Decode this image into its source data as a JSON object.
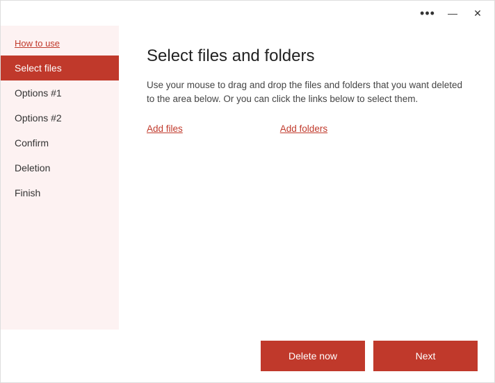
{
  "titleBar": {
    "dotsLabel": "•••",
    "minimizeLabel": "—",
    "closeLabel": "✕"
  },
  "sidebar": {
    "items": [
      {
        "id": "how-to-use",
        "label": "How to use",
        "active": false,
        "isLink": true
      },
      {
        "id": "select-files",
        "label": "Select files",
        "active": true,
        "isLink": false
      },
      {
        "id": "options-1",
        "label": "Options #1",
        "active": false,
        "isLink": false
      },
      {
        "id": "options-2",
        "label": "Options #2",
        "active": false,
        "isLink": false
      },
      {
        "id": "confirm",
        "label": "Confirm",
        "active": false,
        "isLink": false
      },
      {
        "id": "deletion",
        "label": "Deletion",
        "active": false,
        "isLink": false
      },
      {
        "id": "finish",
        "label": "Finish",
        "active": false,
        "isLink": false
      }
    ]
  },
  "main": {
    "title": "Select files and folders",
    "description": "Use your mouse to drag and drop the files and folders that you want deleted to the area below. Or you can click the links below to select them.",
    "addFilesLabel": "Add files",
    "addFoldersLabel": "Add folders"
  },
  "footer": {
    "deleteNowLabel": "Delete now",
    "nextLabel": "Next"
  }
}
